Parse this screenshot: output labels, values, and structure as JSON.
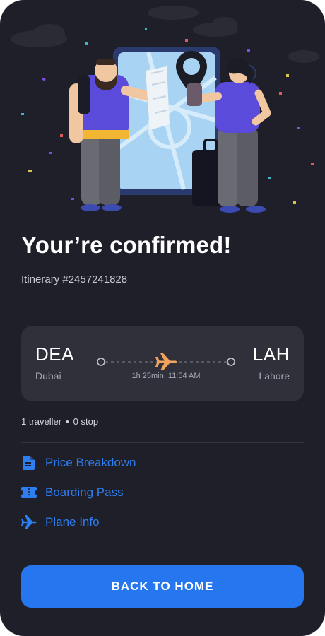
{
  "confirmation": {
    "title": "Your’re confirmed!",
    "itinerary": "Itinerary #2457241828"
  },
  "flight": {
    "from_code": "DEA",
    "from_city": "Dubai",
    "to_code": "LAH",
    "to_city": "Lahore",
    "duration": "1h 25min, 11:54 AM",
    "plane_icon": "plane-icon"
  },
  "trip_meta": {
    "travellers": "1 traveller",
    "separator": "•",
    "stops": "0 stop"
  },
  "links": [
    {
      "label": "Price Breakdown",
      "icon": "document-icon"
    },
    {
      "label": "Boarding Pass",
      "icon": "ticket-icon"
    },
    {
      "label": "Plane Info",
      "icon": "plane-icon"
    }
  ],
  "actions": {
    "back_home": "BACK TO HOME"
  },
  "colors": {
    "background": "#1f1f29",
    "card": "#2f3039",
    "accent": "#2677ef",
    "plane": "#f3a35c"
  }
}
